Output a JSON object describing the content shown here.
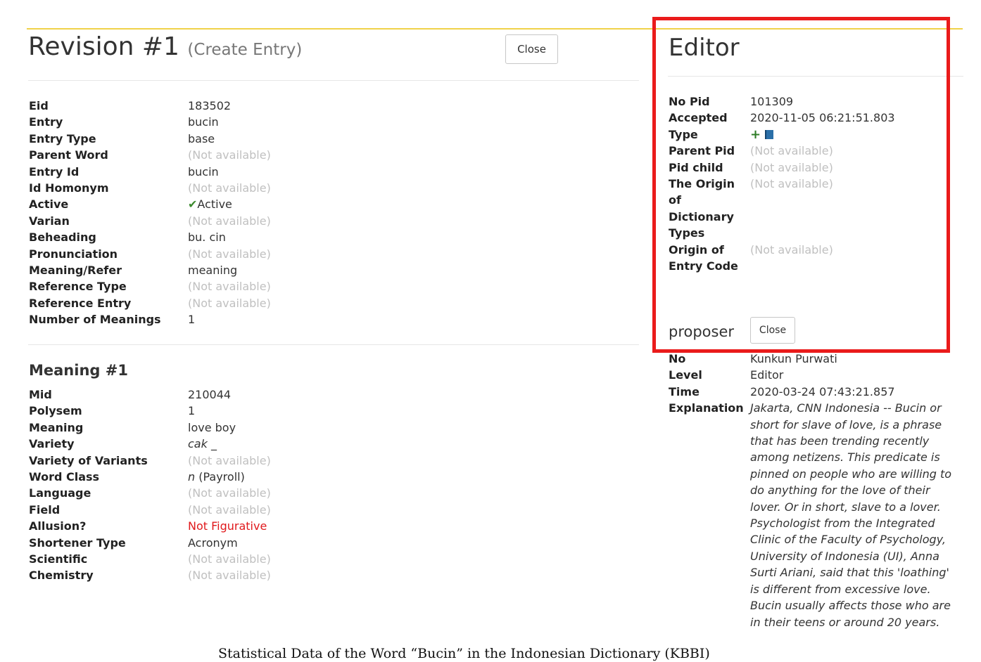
{
  "revision": {
    "title": "Revision #1",
    "subtitle": "(Create Entry)",
    "close_label": "Close",
    "fields": [
      {
        "label": "Eid",
        "value": "183502"
      },
      {
        "label": "Entry",
        "value": "bucin"
      },
      {
        "label": "Entry Type",
        "value": "base"
      },
      {
        "label": "Parent Word",
        "value": "(Not available)"
      },
      {
        "label": "Entry Id",
        "value": "bucin"
      },
      {
        "label": "Id Homonym",
        "value": "(Not available)"
      },
      {
        "label": "Active",
        "value": "Active"
      },
      {
        "label": "Varian",
        "value": "(Not available)"
      },
      {
        "label": "Beheading",
        "value": "bu. cin"
      },
      {
        "label": "Pronunciation",
        "value": "(Not available)"
      },
      {
        "label": "Meaning/Refer",
        "value": "meaning"
      },
      {
        "label": "Reference Type",
        "value": "(Not available)"
      },
      {
        "label": "Reference Entry",
        "value": "(Not available)"
      },
      {
        "label": "Number of Meanings",
        "value": "1"
      }
    ]
  },
  "meaning": {
    "title": "Meaning #1",
    "fields": [
      {
        "label": "Mid",
        "value": "210044"
      },
      {
        "label": "Polysem",
        "value": "1"
      },
      {
        "label": "Meaning",
        "value": "love boy"
      },
      {
        "label": "Variety",
        "value": "cak _"
      },
      {
        "label": "Variety of Variants",
        "value": "(Not available)"
      },
      {
        "label": "Word Class",
        "value_abbr": "n",
        "value": "(Payroll)"
      },
      {
        "label": "Language",
        "value": "(Not available)"
      },
      {
        "label": "Field",
        "value": "(Not available)"
      },
      {
        "label": "Allusion?",
        "value": "Not Figurative"
      },
      {
        "label": "Shortener Type",
        "value": "Acronym"
      },
      {
        "label": "Scientific",
        "value": "(Not available)"
      },
      {
        "label": "Chemistry",
        "value": "(Not available)"
      }
    ]
  },
  "editor": {
    "title": "Editor",
    "fields": [
      {
        "label": "No Pid",
        "value": "101309"
      },
      {
        "label": "Accepted",
        "value": "2020-11-05 06:21:51.803"
      },
      {
        "label": "Type",
        "icons": [
          "plus-icon",
          "book-icon"
        ]
      },
      {
        "label": "Parent Pid",
        "value": "(Not available)"
      },
      {
        "label": "Pid child",
        "value": "(Not available)"
      },
      {
        "label": "The Origin of Dictionary Types",
        "value": "(Not available)"
      },
      {
        "label": "Origin of Entry Code",
        "value": "(Not available)"
      }
    ],
    "proposer_label": "proposer",
    "close_label": "Close"
  },
  "proposer": {
    "fields": [
      {
        "label": "No",
        "value": "Kunkun Purwati"
      },
      {
        "label": "Level",
        "value": "Editor"
      },
      {
        "label": "Time",
        "value": "2020-03-24 07:43:21.857"
      },
      {
        "label": "Explanation",
        "value": "Jakarta, CNN Indonesia -- Bucin or short for slave of love, is a phrase that has been trending recently among netizens. This predicate is pinned on people who are willing to do anything for the love of their lover. Or in short, slave to a lover. Psychologist from the Integrated Clinic of the Faculty of Psychology, University of Indonesia (UI), Anna Surti Ariani, said that this 'loathing' is different from excessive love. Bucin usually affects those who are in their teens or around 20 years."
      }
    ]
  },
  "caption": "Statistical Data of the Word “Bucin” in the Indonesian Dictionary (KBBI)",
  "colors": {
    "accent_line": "#f0d24a",
    "highlight_box": "#ea1b1b",
    "not_available": "#c0c0c0",
    "not_figurative": "#e0191c",
    "active_check": "#3c8a2e"
  }
}
